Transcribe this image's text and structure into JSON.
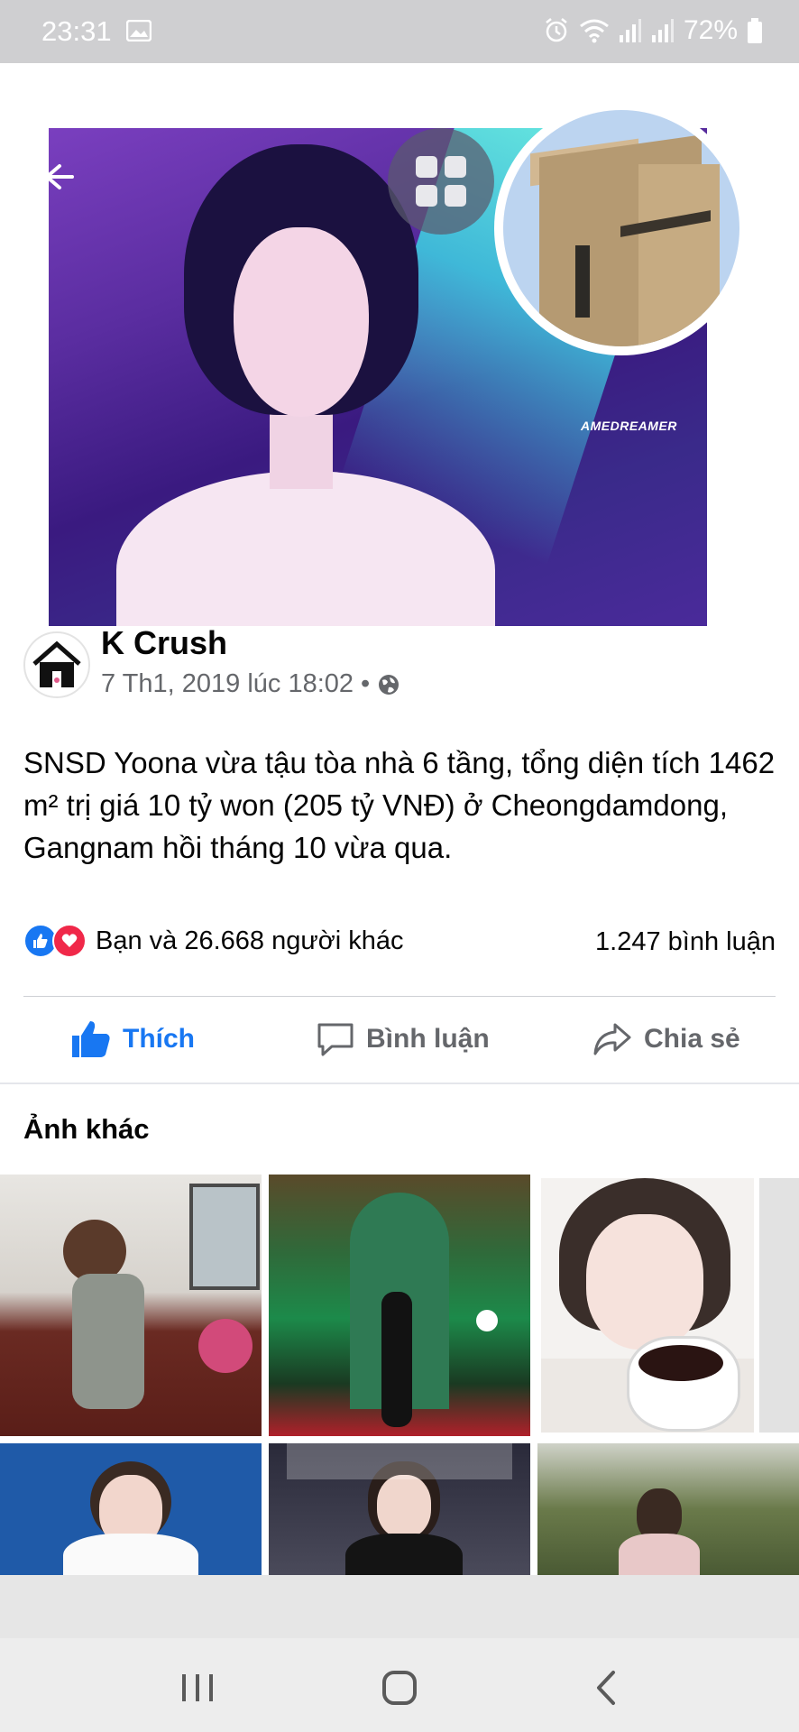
{
  "status_bar": {
    "time": "23:31",
    "battery": "72%",
    "icons": [
      "gallery-icon",
      "alarm-icon",
      "wifi-icon",
      "signal-icon",
      "signal-icon",
      "battery-icon"
    ]
  },
  "header": {
    "back_icon": "back-arrow-icon",
    "grid_icon": "grid-icon",
    "photo_watermark": "AMEDREAMER"
  },
  "post": {
    "page_name": "K Crush",
    "timestamp": "7 Th1, 2019 lúc 18:02",
    "separator": "•",
    "privacy_icon": "globe-icon",
    "text": "SNSD Yoona vừa tậu tòa nhà 6 tầng, tổng diện tích 1462 m² trị giá 10 tỷ won (205 tỷ VNĐ) ở Cheongdamdong, Gangnam hồi tháng 10 vừa qua.",
    "reactions_text": "Bạn và 26.668 người khác",
    "comments_count": "1.247 bình luận",
    "actions": {
      "like": "Thích",
      "comment": "Bình luận",
      "share": "Chia sẻ"
    }
  },
  "more_photos": {
    "title": "Ảnh khác"
  },
  "colors": {
    "accent": "#1877f2",
    "love": "#f02849",
    "muted": "#65676b",
    "status_bar": "#cfcfd1"
  }
}
